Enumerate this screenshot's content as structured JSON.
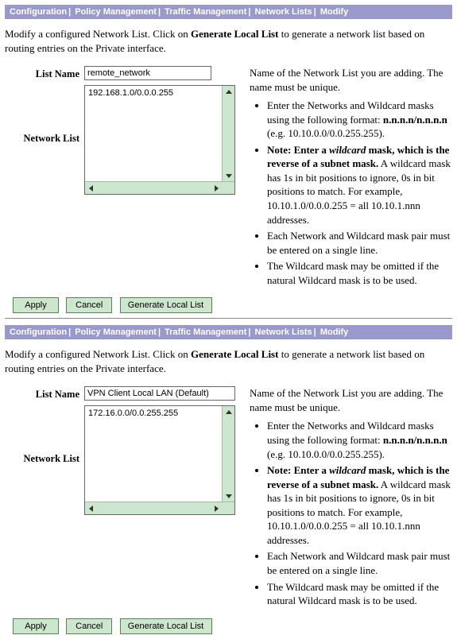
{
  "breadcrumb": [
    "Configuration",
    "Policy Management",
    "Traffic Management",
    "Network Lists",
    "Modify"
  ],
  "desc_before": "Modify a configured Network List. Click on ",
  "desc_bold": "Generate Local List",
  "desc_after": " to generate a network list based on routing entries on the Private interface.",
  "labels": {
    "list_name": "List Name",
    "network_list": "Network List"
  },
  "help_intro": "Name of the Network List you are adding. The name must be unique.",
  "hint1_a": "Enter the Networks and Wildcard masks using the following format: ",
  "hint1_b": "n.n.n.n/n.n.n.n",
  "hint1_c": " (e.g. 10.10.0.0/0.0.255.255).",
  "hint2_a": "Note: Enter a ",
  "hint2_b": "wildcard",
  "hint2_c": " mask, which is the reverse of a subnet mask.",
  "hint2_d": " A wildcard mask has 1s in bit positions to ignore, 0s in bit positions to match. For example, 10.10.1.0/0.0.0.255 = all 10.10.1.nnn addresses.",
  "hint3": "Each Network and Wildcard mask pair must be entered on a single line.",
  "hint4": "The Wildcard mask may be omitted if the natural Wildcard mask is to be used.",
  "buttons": {
    "apply": "Apply",
    "cancel": "Cancel",
    "generate": "Generate Local List"
  },
  "panel1": {
    "list_name": "remote_network",
    "network_list": "192.168.1.0/0.0.0.255"
  },
  "panel2": {
    "list_name": "VPN Client Local LAN (Default)",
    "network_list": "172.16.0.0/0.0.255.255"
  }
}
